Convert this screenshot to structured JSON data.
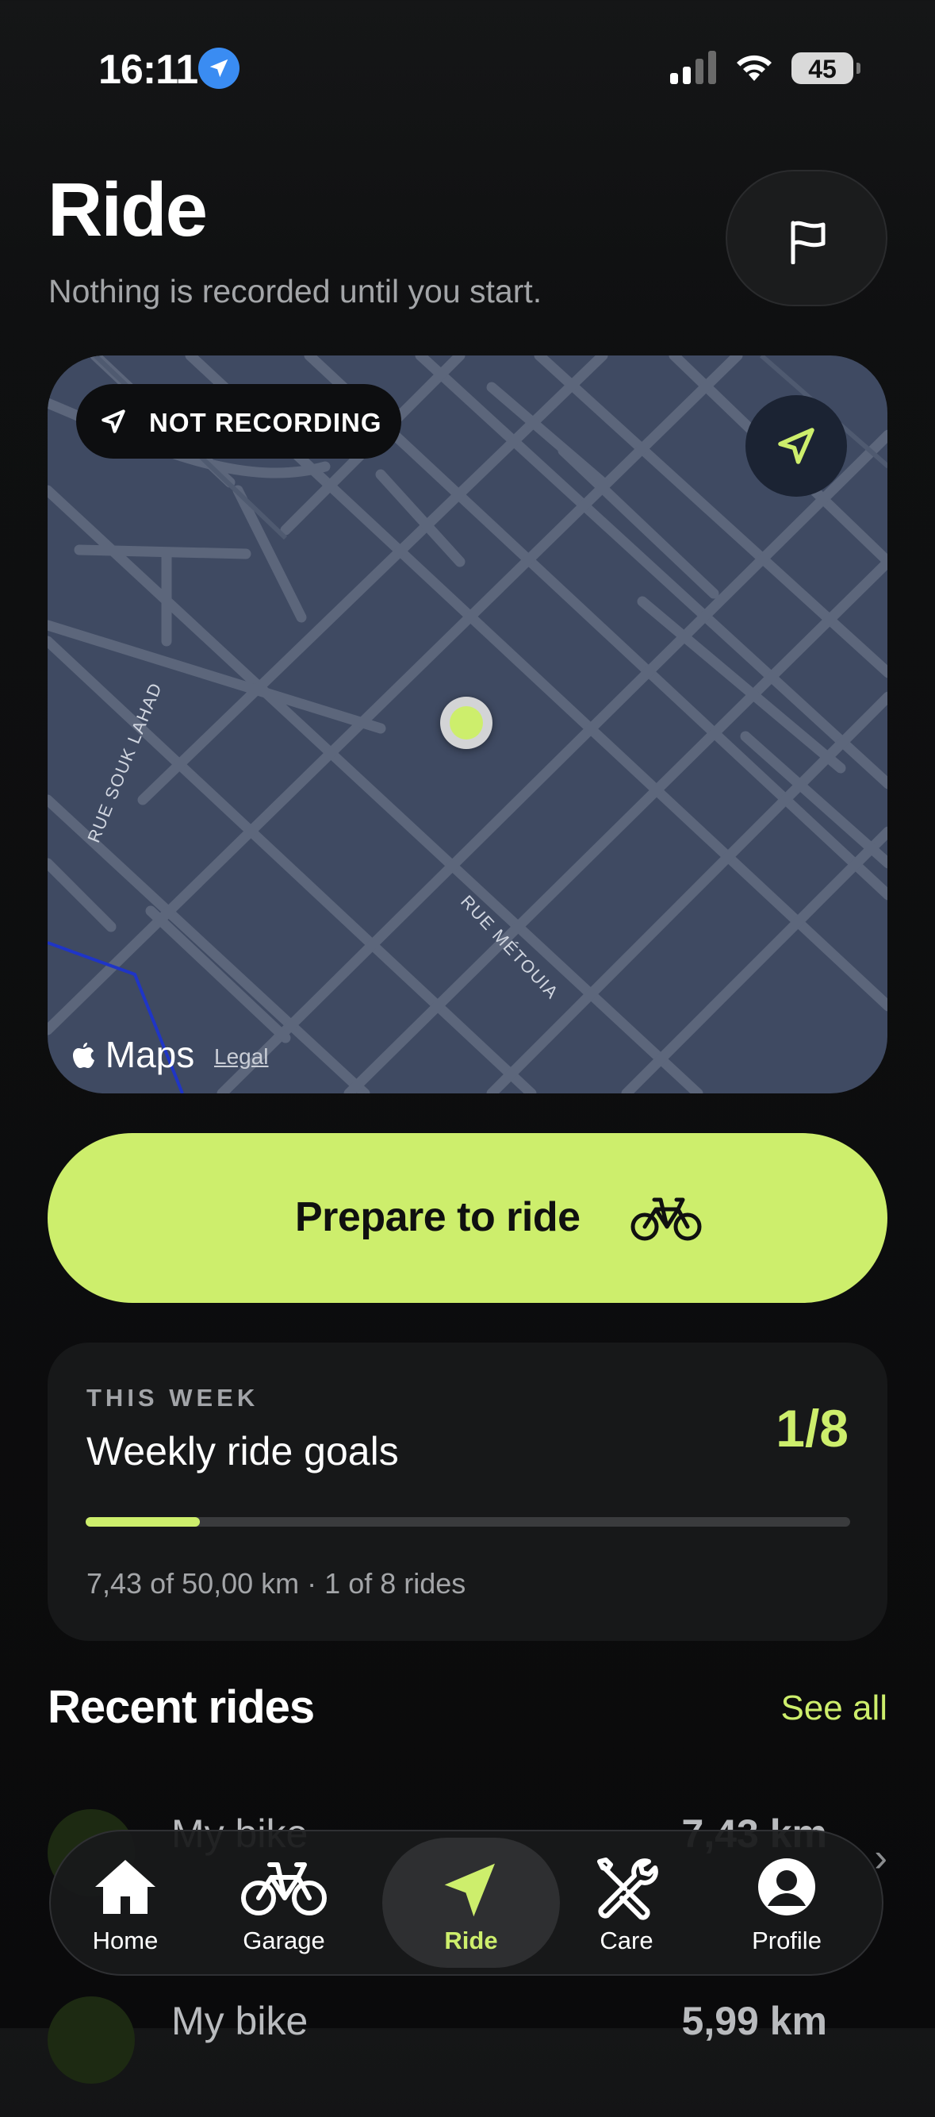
{
  "status_bar": {
    "time": "16:11",
    "battery": "45"
  },
  "header": {
    "title": "Ride",
    "subtitle": "Nothing is recorded until you start."
  },
  "map": {
    "recording_status": "NOT RECORDING",
    "street_labels": [
      "RUE SOUK LAHAD",
      "RUE MÉTOUIA"
    ],
    "attribution": "Maps",
    "legal_link": "Legal"
  },
  "cta": {
    "label": "Prepare to ride"
  },
  "weekly_goals": {
    "eyebrow": "THIS WEEK",
    "title": "Weekly ride goals",
    "count": "1/8",
    "progress_fraction": 0.149,
    "summary": "7,43 of 50,00 km · 1 of 8 rides"
  },
  "recent_rides": {
    "title": "Recent rides",
    "see_all": "See all",
    "items": [
      {
        "name": "My bike",
        "distance": "7,43 km"
      },
      {
        "name": "My bike",
        "distance": "5,99 km"
      }
    ]
  },
  "tab_bar": {
    "tabs": [
      {
        "label": "Home",
        "icon": "house-icon"
      },
      {
        "label": "Garage",
        "icon": "bicycle-icon"
      },
      {
        "label": "Ride",
        "icon": "navigation-arrow-icon",
        "active": true
      },
      {
        "label": "Care",
        "icon": "wrench-screwdriver-icon"
      },
      {
        "label": "Profile",
        "icon": "person-circle-icon"
      }
    ]
  },
  "colors": {
    "accent": "#cdee6c",
    "background": "#0f1011",
    "card": "#171819",
    "map": "#3f4a62"
  }
}
